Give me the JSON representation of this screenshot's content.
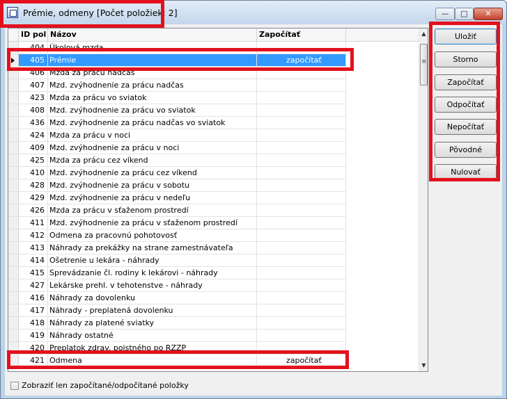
{
  "window": {
    "title": "Prémie, odmeny [Počet položiek: 2]",
    "controls": {
      "minimize": "—",
      "maximize": "□",
      "close": "✕"
    }
  },
  "grid": {
    "columns": {
      "id": "ID pol",
      "name": "Názov",
      "calc": "Započítať"
    },
    "rows": [
      {
        "id": "404",
        "name": "Úkolová mzda",
        "calc": ""
      },
      {
        "id": "405",
        "name": "Prémie",
        "calc": "započítať"
      },
      {
        "id": "406",
        "name": "Mzda za prácu nadčas",
        "calc": ""
      },
      {
        "id": "407",
        "name": "Mzd. zvýhodnenie za prácu nadčas",
        "calc": ""
      },
      {
        "id": "423",
        "name": "Mzda za prácu vo sviatok",
        "calc": ""
      },
      {
        "id": "408",
        "name": "Mzd. zvýhodnenie za prácu vo sviatok",
        "calc": ""
      },
      {
        "id": "436",
        "name": "Mzd. zvýhodnenie za prácu nadčas vo sviatok",
        "calc": ""
      },
      {
        "id": "424",
        "name": "Mzda za prácu v noci",
        "calc": ""
      },
      {
        "id": "409",
        "name": "Mzd. zvýhodnenie za prácu v noci",
        "calc": ""
      },
      {
        "id": "425",
        "name": "Mzda za prácu cez víkend",
        "calc": ""
      },
      {
        "id": "410",
        "name": "Mzd. zvýhodnenie za prácu cez víkend",
        "calc": ""
      },
      {
        "id": "428",
        "name": "Mzd. zvýhodnenie za prácu v sobotu",
        "calc": ""
      },
      {
        "id": "429",
        "name": "Mzd. zvýhodnenie za prácu v nedeľu",
        "calc": ""
      },
      {
        "id": "426",
        "name": "Mzda za prácu v sťaženom prostredí",
        "calc": ""
      },
      {
        "id": "411",
        "name": "Mzd. zvýhodnenie za prácu v sťaženom prostredí",
        "calc": ""
      },
      {
        "id": "412",
        "name": "Odmena za pracovnú pohotovosť",
        "calc": ""
      },
      {
        "id": "413",
        "name": "Náhrady za prekážky na strane zamestnávateľa",
        "calc": ""
      },
      {
        "id": "414",
        "name": "Ošetrenie u lekára - náhrady",
        "calc": ""
      },
      {
        "id": "415",
        "name": "Sprevádzanie čl. rodiny k lekárovi - náhrady",
        "calc": ""
      },
      {
        "id": "427",
        "name": "Lekárske prehl. v tehotenstve - náhrady",
        "calc": ""
      },
      {
        "id": "416",
        "name": "Náhrady za dovolenku",
        "calc": ""
      },
      {
        "id": "417",
        "name": "Náhrady - preplatená dovolenku",
        "calc": ""
      },
      {
        "id": "418",
        "name": "Náhrady za platené sviatky",
        "calc": ""
      },
      {
        "id": "419",
        "name": "Náhrady ostatné",
        "calc": ""
      },
      {
        "id": "420",
        "name": "Preplatok zdrav. poistného po RZZP",
        "calc": ""
      },
      {
        "id": "421",
        "name": "Odmena",
        "calc": "započítať"
      }
    ],
    "selected_row_id": "405"
  },
  "buttons": {
    "save": "Uložiť",
    "cancel": "Storno",
    "include": "Započítať",
    "exclude": "Odpočítať",
    "dont_include": "Nepočítať",
    "original": "Pôvodné",
    "reset": "Nulovať"
  },
  "footer": {
    "filter_checkbox_label": "Zobraziť len započítané/odpočítané položky",
    "filter_checked": false
  },
  "colors": {
    "highlight": "#e3111d",
    "selection": "#3399ff"
  }
}
